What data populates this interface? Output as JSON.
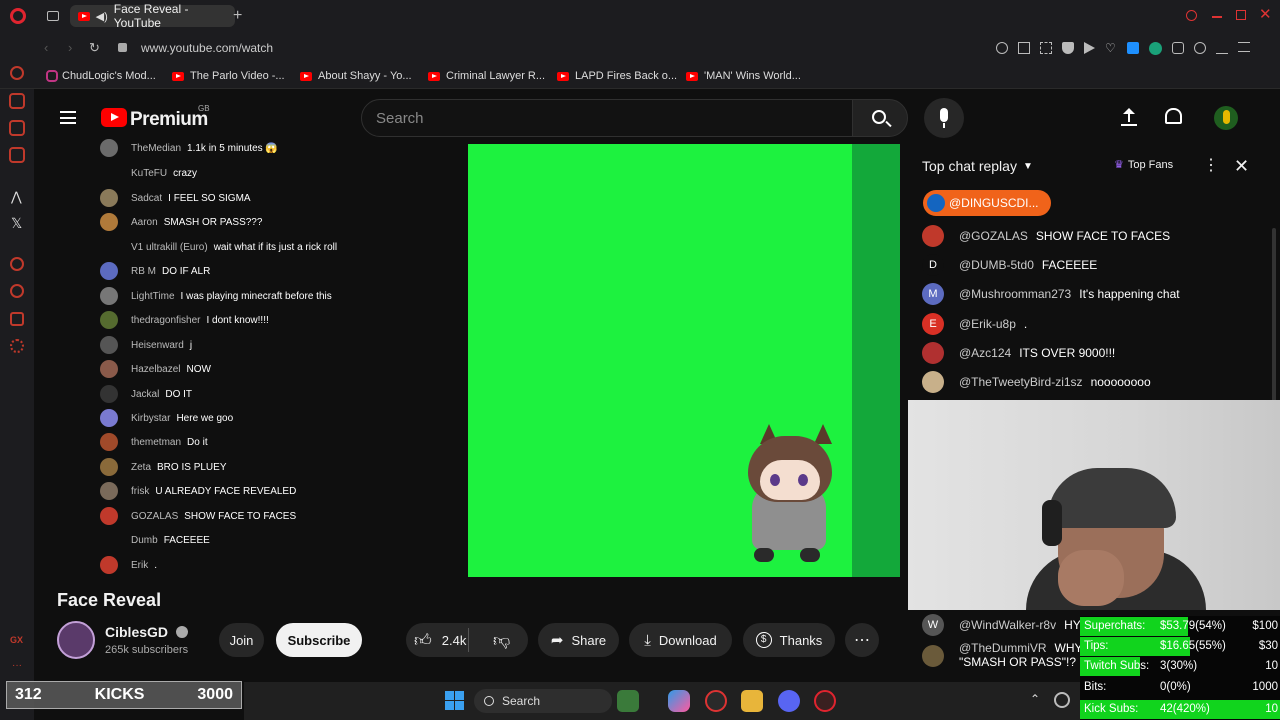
{
  "browser": {
    "tab_title": "Face Reveal - YouTube",
    "url": "www.youtube.com/watch",
    "bookmarks": [
      "ChudLogic's Mod...",
      "The Parlo Video -...",
      "About Shayy - Yo...",
      "Criminal Lawyer R...",
      "LAPD Fires Back o...",
      "'MAN' Wins World..."
    ]
  },
  "youtube": {
    "logo_text": "Premium",
    "logo_region": "GB",
    "search_placeholder": "Search"
  },
  "left_chat": [
    {
      "name": "TheMedian",
      "msg": "1.1k in 5 minutes 😱",
      "color": "#6b6b6b"
    },
    {
      "name": "KuTeFU",
      "msg": "crazy",
      "color": "transparent"
    },
    {
      "name": "Sadcat",
      "msg": "I FEEL SO SIGMA",
      "color": "#8a7a5a"
    },
    {
      "name": "Aaron",
      "msg": "SMASH OR PASS???",
      "color": "#b07a3a"
    },
    {
      "name": "V1 ultrakill (Euro)",
      "msg": "wait what if its just a rick roll",
      "color": "transparent"
    },
    {
      "name": "RB M",
      "msg": "DO IF ALR",
      "color": "#5c6bc0"
    },
    {
      "name": "LightTime",
      "msg": "I was playing minecraft before this",
      "color": "#777"
    },
    {
      "name": "thedragonfisher",
      "msg": "I dont know!!!!",
      "color": "#556b2f"
    },
    {
      "name": "Heisenward",
      "msg": "j",
      "color": "#555"
    },
    {
      "name": "Hazelbazel",
      "msg": "NOW",
      "color": "#8a5a4a"
    },
    {
      "name": "Jackal",
      "msg": "DO IT",
      "color": "#333"
    },
    {
      "name": "Kirbystar",
      "msg": "Here we goo",
      "color": "#7a7ad0"
    },
    {
      "name": "themetman",
      "msg": "Do it",
      "color": "#a04a2a"
    },
    {
      "name": "Zeta",
      "msg": "BRO IS PLUEY",
      "color": "#8a6a3a"
    },
    {
      "name": "frisk",
      "msg": "U ALREADY FACE REVEALED",
      "color": "#7a6a5a"
    },
    {
      "name": "GOZALAS",
      "msg": "SHOW FACE TO FACES",
      "color": "#c0392b"
    },
    {
      "name": "Dumb",
      "msg": "FACEEEE",
      "color": "transparent"
    },
    {
      "name": "Erik",
      "msg": ".",
      "color": "#c0392b"
    }
  ],
  "right_chat": {
    "title": "Top chat replay",
    "top_fans_label": "Top Fans",
    "pinned_user": "@DINGUSCDI...",
    "messages": [
      {
        "name": "@GOZALAS",
        "msg": "SHOW FACE TO FACES",
        "initial": "",
        "color": "#c0392b"
      },
      {
        "name": "@DUMB-5td0",
        "msg": "FACEEEE",
        "initial": "D",
        "color": "#0f0f0f"
      },
      {
        "name": "@Mushroomman273",
        "msg": "It's happening chat",
        "initial": "M",
        "color": "#5c6bc0"
      },
      {
        "name": "@Erik-u8p",
        "msg": ".",
        "initial": "E",
        "color": "#d93025"
      },
      {
        "name": "@Azc124",
        "msg": "ITS OVER 9000!!!",
        "initial": "",
        "color": "#b03030"
      },
      {
        "name": "@TheTweetyBird-zi1sz",
        "msg": "noooooooo",
        "initial": "",
        "color": "#c8b08a"
      }
    ],
    "bottom_messages": [
      {
        "name": "@WindWalker-r8v",
        "msg": "HY!",
        "initial": "W",
        "color": "#555"
      },
      {
        "name": "@TheDummiVR",
        "msg": "WHY",
        "msg2": "\"SMASH OR PASS\"!?",
        "initial": "",
        "color": "#6a5a3a"
      }
    ]
  },
  "stats": [
    {
      "label": "Superchats:",
      "value": "$53.79(54%)",
      "goal": "$100",
      "pct": 0.54
    },
    {
      "label": "Tips:",
      "value": "$16.65(55%)",
      "goal": "$30",
      "pct": 0.55
    },
    {
      "label": "Twitch Subs:",
      "value": "3(30%)",
      "goal": "10",
      "pct": 0.3
    },
    {
      "label": "Bits:",
      "value": "0(0%)",
      "goal": "1000",
      "pct": 0
    },
    {
      "label": "Kick Subs:",
      "value": "42(420%)",
      "goal": "10",
      "pct": 1
    }
  ],
  "video": {
    "title": "Face Reveal",
    "channel": "CiblesGD",
    "subscribers": "265k subscribers",
    "join_label": "Join",
    "subscribe_label": "Subscribe",
    "likes": "2.4k",
    "share_label": "Share",
    "download_label": "Download",
    "thanks_label": "Thanks"
  },
  "kicks_overlay": {
    "current": "312",
    "label": "KICKS",
    "goal": "3000"
  },
  "taskbar": {
    "search_label": "Search"
  }
}
